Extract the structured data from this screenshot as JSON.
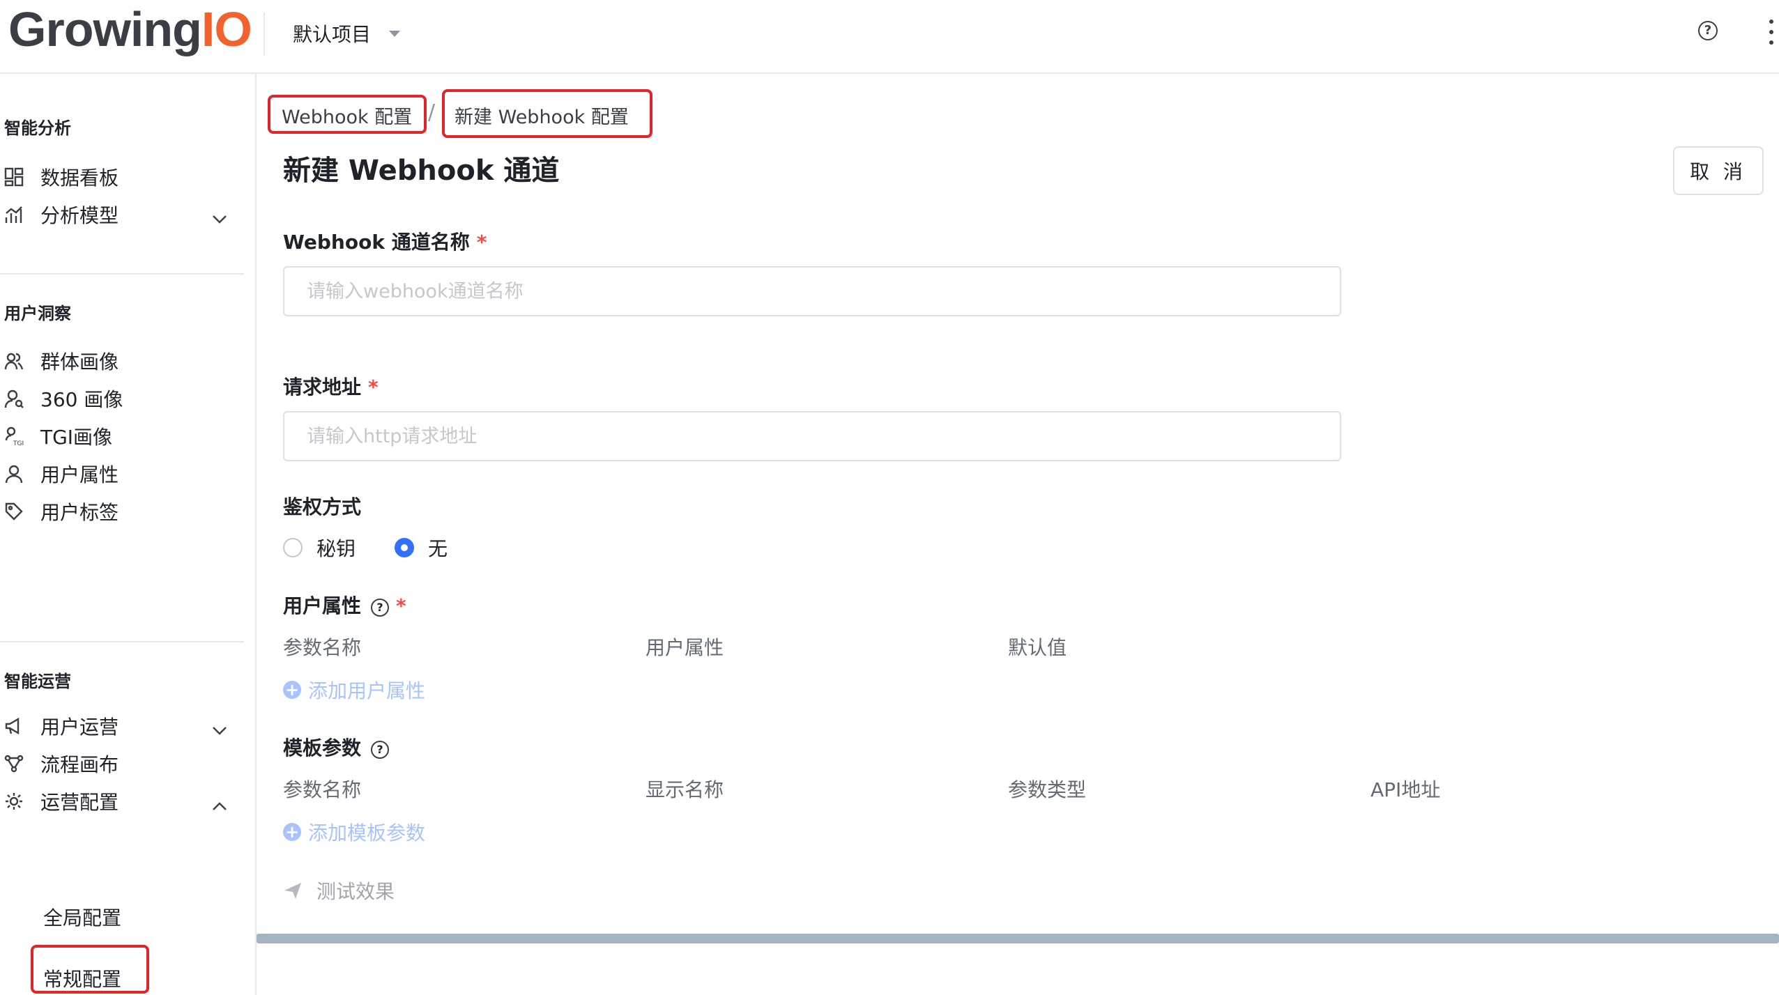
{
  "header": {
    "logo_main": "Growing",
    "logo_accent": "IO",
    "project_name": "默认项目",
    "help_symbol": "?",
    "more_icon": "vertical-ellipsis-icon"
  },
  "sidebar": {
    "sections": [
      {
        "title": "智能分析"
      },
      {
        "title": "用户洞察"
      },
      {
        "title": "智能运营"
      }
    ],
    "items": [
      {
        "label": "数据看板",
        "icon": "dashboard-icon"
      },
      {
        "label": "分析模型",
        "icon": "chart-icon",
        "chevron": "down"
      },
      {
        "label": "群体画像",
        "icon": "group-users-icon"
      },
      {
        "label": "360 画像",
        "icon": "user-search-icon"
      },
      {
        "label": "TGI画像",
        "icon": "tgi-icon"
      },
      {
        "label": "用户属性",
        "icon": "user-icon"
      },
      {
        "label": "用户标签",
        "icon": "tag-icon"
      },
      {
        "label": "用户运营",
        "icon": "megaphone-icon",
        "chevron": "down"
      },
      {
        "label": "流程画布",
        "icon": "flow-icon"
      },
      {
        "label": "运营配置",
        "icon": "settings-icon",
        "chevron": "up"
      }
    ],
    "sub_items": [
      {
        "label": "全局配置"
      },
      {
        "label": "常规配置"
      }
    ]
  },
  "breadcrumb": {
    "parent": "Webhook 配置",
    "separator": "/",
    "current": "新建 Webhook 配置"
  },
  "page": {
    "title": "新建 Webhook 通道",
    "cancel_label": "取 消"
  },
  "form": {
    "name_label": "Webhook 通道名称",
    "name_placeholder": "请输入webhook通道名称",
    "url_label": "请求地址",
    "url_placeholder": "请输入http请求地址",
    "required_mark": "*",
    "auth_label": "鉴权方式",
    "auth_options": [
      {
        "label": "秘钥",
        "checked": false
      },
      {
        "label": "无",
        "checked": true
      }
    ],
    "user_attr_label": "用户属性",
    "user_attr_columns": [
      "参数名称",
      "用户属性",
      "默认值"
    ],
    "add_user_attr": "添加用户属性",
    "template_label": "模板参数",
    "template_columns": [
      "参数名称",
      "显示名称",
      "参数类型",
      "API地址"
    ],
    "add_template": "添加模板参数",
    "test_label": "测试效果"
  },
  "colors": {
    "accent": "#3370ff",
    "highlight_box": "#e0262b",
    "logo_accent": "#f2622e"
  }
}
